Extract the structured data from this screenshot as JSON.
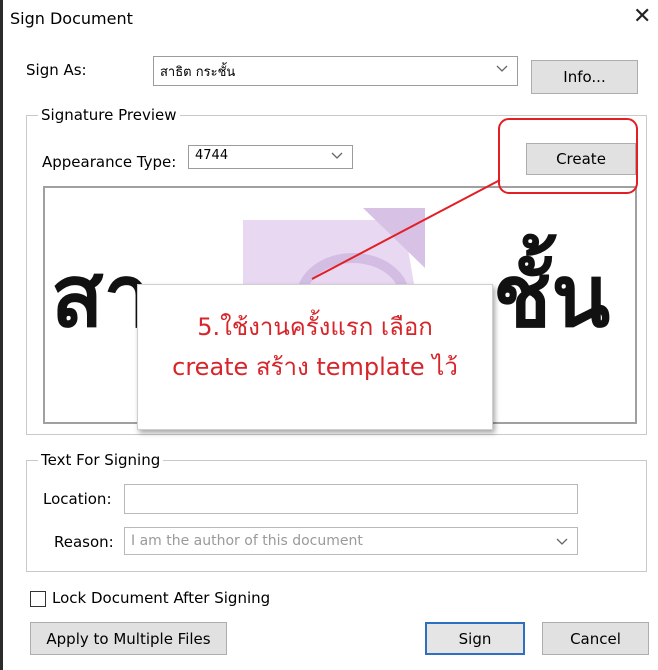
{
  "dialog": {
    "title": "Sign Document"
  },
  "sign_as": {
    "label": "Sign As:",
    "value": "สาธิต กระชั้น",
    "info_label": "Info..."
  },
  "signature_preview": {
    "legend": "Signature Preview",
    "appearance_label": "Appearance Type:",
    "appearance_value": "4744",
    "create_label": "Create",
    "preview_left": "สา",
    "preview_right": "ชั้น"
  },
  "annotation": {
    "line1": "5.ใช้งานครั้งแรก เลือก",
    "line2": "create สร้าง template ไว้",
    "color": "#e31e24"
  },
  "text_for_signing": {
    "legend": "Text For Signing",
    "location_label": "Location:",
    "location_value": "",
    "reason_label": "Reason:",
    "reason_placeholder": "I am the author of this document"
  },
  "lock_after_signing": {
    "label": "Lock Document After Signing",
    "checked": false
  },
  "buttons": {
    "multiple": "Apply to Multiple Files",
    "sign": "Sign",
    "cancel": "Cancel"
  }
}
